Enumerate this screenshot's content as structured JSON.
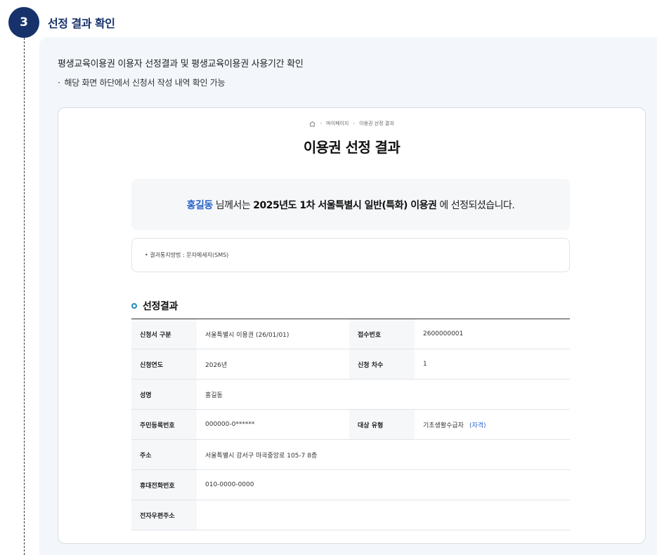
{
  "step": {
    "number": "3",
    "title": "선정 결과 확인"
  },
  "description": {
    "main": "평생교육이용권 이용자 선정결과 및 평생교육이용권 사용기간 확인",
    "bullet_dot": "·",
    "bullet": "해당 화면 하단에서 신청서 작성 내역 확인 가능"
  },
  "breadcrumb": {
    "items": [
      "마이페이지",
      "이용권 선정 결과"
    ],
    "separator": "›",
    "home_icon": "home-icon"
  },
  "page_title": "이용권 선정 결과",
  "result": {
    "name": "홍길동",
    "text1": " 님께서는 ",
    "program": "2025년도 1차 서울특별시 일반(특화) 이용권",
    "text2": " 에 선정되셨습니다."
  },
  "notice": "• 결과통지방법 : 문자메세지(SMS)",
  "section": {
    "title": "선정결과"
  },
  "table": {
    "apply_type_label": "신청서 구분",
    "apply_type_value": "서울특별시 이용권 (26/01/01)",
    "receipt_label": "접수번호",
    "receipt_value": "2600000001",
    "year_label": "신청연도",
    "year_value": "2026년",
    "round_label": "신청 차수",
    "round_value": "1",
    "name_label": "성명",
    "name_value": "홍길동",
    "rrn_label": "주민등록번호",
    "rrn_value": "000000-0******",
    "target_label": "대상 유형",
    "target_value": "기초생활수급자",
    "target_link": "(자격)",
    "address_label": "주소",
    "address_value": "서울특별시 강서구 마곡중앙로 105-7 8층",
    "phone_label": "휴대전화번호",
    "phone_value": "010-0000-0000",
    "email_label": "전자우편주소",
    "email_value": ""
  },
  "colors": {
    "accent": "#17326b",
    "link": "#2a63c9",
    "ring": "#1e8bc3",
    "panel": "#f3f7fc"
  }
}
